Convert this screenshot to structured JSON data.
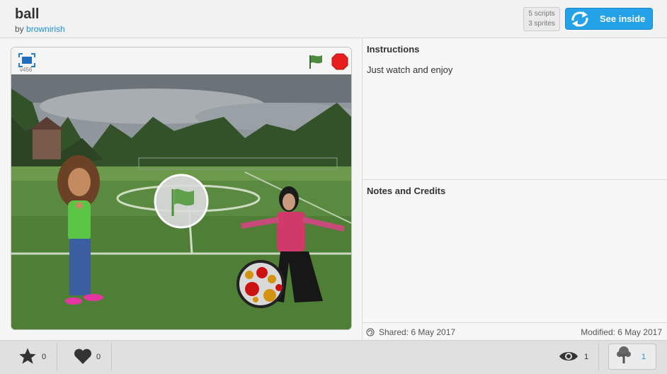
{
  "project": {
    "title": "ball",
    "by_label": "by",
    "author": "brownirish",
    "scripts": "5 scripts",
    "sprites": "3 sprites",
    "see_inside": "See inside"
  },
  "player": {
    "version": "v456",
    "icons": [
      "fullscreen-icon",
      "green-flag-icon",
      "stop-icon"
    ]
  },
  "sidebar": {
    "instructions_title": "Instructions",
    "instructions_text": "Just watch and enjoy",
    "notes_title": "Notes and Credits",
    "notes_text": "",
    "shared": "Shared: 6 May 2017",
    "modified": "Modified: 6 May 2017"
  },
  "footer": {
    "loves": "0",
    "favorites": "0",
    "views": "1",
    "remixes": "1"
  },
  "colors": {
    "accent": "#24a2e8",
    "link": "#1a90d8",
    "flag": "#4c8a3c",
    "stop": "#e81e1e"
  }
}
